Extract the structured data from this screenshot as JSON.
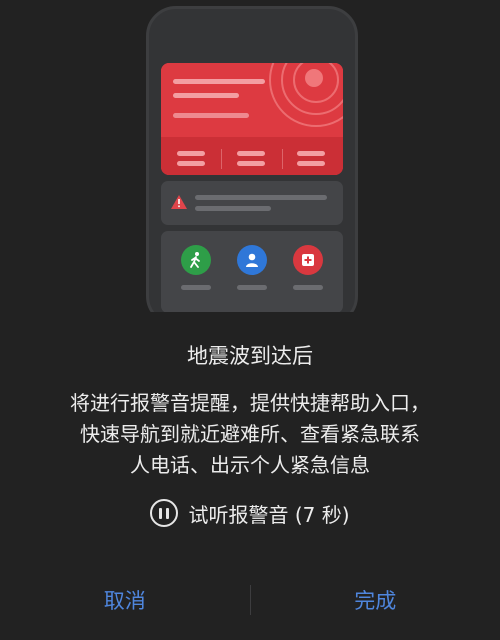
{
  "dialog": {
    "title": "地震波到达后",
    "description_lines": [
      "将进行报警音提醒，提供快捷帮助入口，",
      "快速导航到就近避难所、查看紧急联系",
      "人电话、出示个人紧急信息"
    ],
    "preview_label": "试听报警音 (7 秒)",
    "preview_icon": "pause-circle-icon"
  },
  "buttons": {
    "cancel_label": "取消",
    "done_label": "完成"
  },
  "illustration": {
    "action_icons": [
      "walking-person-icon",
      "contact-person-icon",
      "medical-cross-icon"
    ],
    "colors": {
      "alert_red": "#dd3a41",
      "exit_green": "#2e9e48",
      "contact_blue": "#2f77d8",
      "medical_red": "#d9383f",
      "button_blue": "#4f86dd"
    }
  }
}
